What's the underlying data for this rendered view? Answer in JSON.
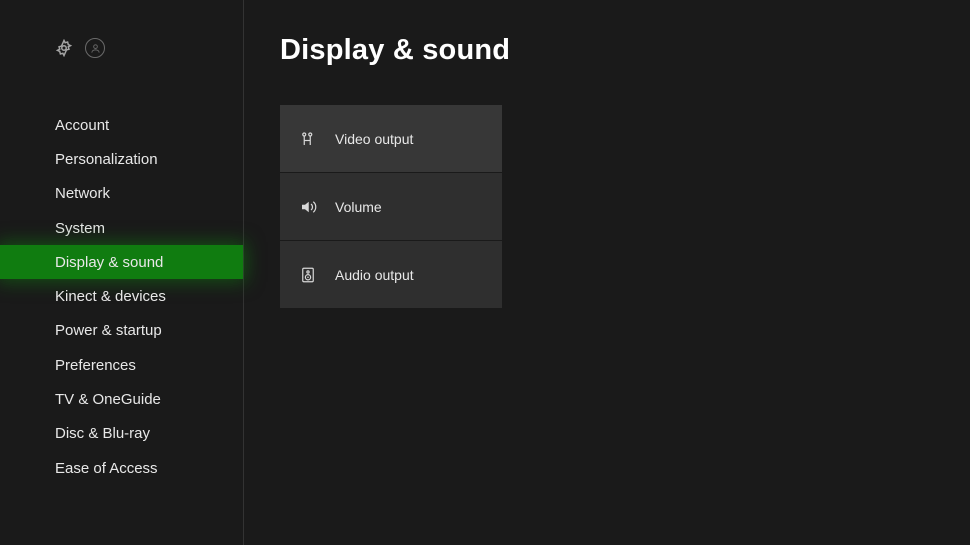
{
  "page_title": "Display & sound",
  "sidebar": {
    "items": [
      {
        "label": "Account",
        "selected": false
      },
      {
        "label": "Personalization",
        "selected": false
      },
      {
        "label": "Network",
        "selected": false
      },
      {
        "label": "System",
        "selected": false
      },
      {
        "label": "Display & sound",
        "selected": true
      },
      {
        "label": "Kinect & devices",
        "selected": false
      },
      {
        "label": "Power & startup",
        "selected": false
      },
      {
        "label": "Preferences",
        "selected": false
      },
      {
        "label": "TV & OneGuide",
        "selected": false
      },
      {
        "label": "Disc & Blu-ray",
        "selected": false
      },
      {
        "label": "Ease of Access",
        "selected": false
      }
    ]
  },
  "tiles": [
    {
      "icon": "video-cable-icon",
      "label": "Video output"
    },
    {
      "icon": "volume-icon",
      "label": "Volume"
    },
    {
      "icon": "audio-output-icon",
      "label": "Audio output"
    }
  ]
}
